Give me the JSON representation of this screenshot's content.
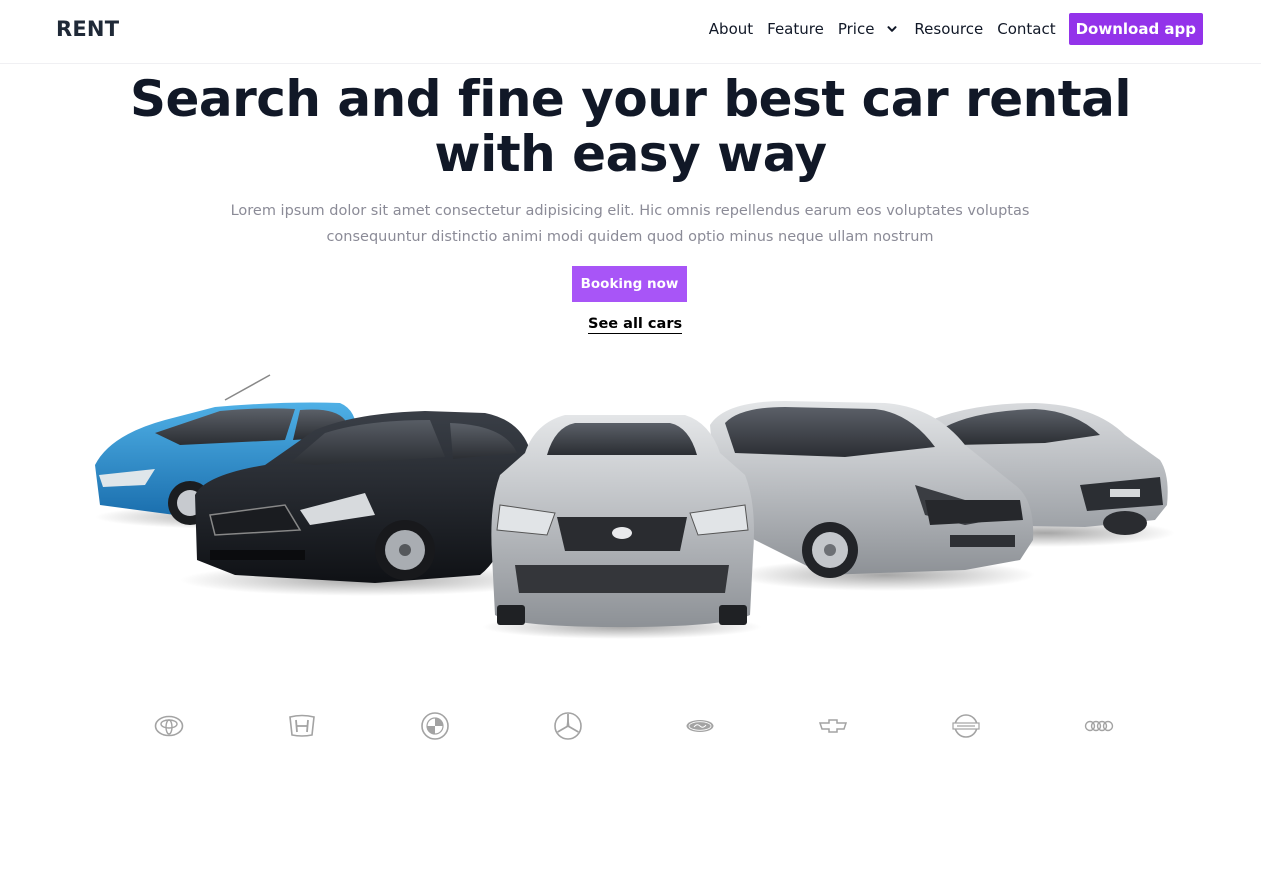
{
  "header": {
    "logo": "RENT",
    "nav": [
      {
        "label": "About"
      },
      {
        "label": "Feature"
      },
      {
        "label": "Price",
        "has_dropdown": true
      },
      {
        "label": "Resource"
      },
      {
        "label": "Contact"
      }
    ],
    "download_button": "Download app"
  },
  "hero": {
    "title_line1": "Search and fine your best car rental",
    "title_line2": "with easy way",
    "description_line1": "Lorem ipsum dolor sit amet consectetur adipisicing elit. Hic omnis repellendus earum eos voluptates voluptas",
    "description_line2": "consequuntur distinctio animi modi quidem quod optio minus neque ullam nostrum",
    "booking_button": "Booking now",
    "see_all_link": "See all cars"
  },
  "cars": [
    "blue-hatchback",
    "black-sedan",
    "silver-sedan-front",
    "silver-minivan",
    "silver-sedan"
  ],
  "brands": [
    "toyota-logo",
    "honda-logo",
    "bmw-logo",
    "mercedes-logo",
    "ford-logo",
    "chevrolet-logo",
    "nissan-logo",
    "audi-logo"
  ],
  "colors": {
    "accent": "#9333ea",
    "booking": "#a855f7",
    "title": "#111827",
    "muted": "#8b8b97",
    "brand_gray": "#a3a3a3"
  }
}
